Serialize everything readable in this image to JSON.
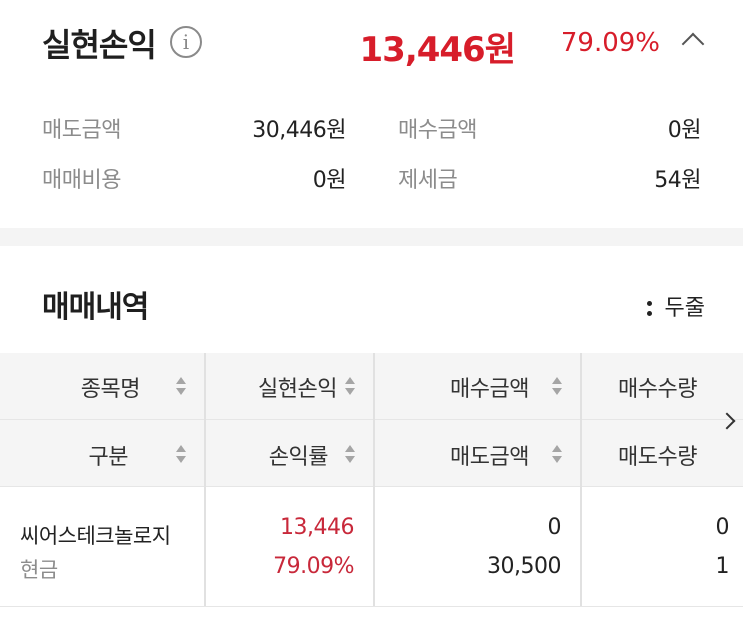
{
  "summary": {
    "title": "실현손익",
    "info_icon": "info-icon",
    "profit": "13,446원",
    "profit_rate": "79.09%",
    "collapse_icon": "chevron-up-icon",
    "sell_amount_label": "매도금액",
    "sell_amount_value": "30,446원",
    "buy_amount_label": "매수금액",
    "buy_amount_value": "0원",
    "trade_cost_label": "매매비용",
    "trade_cost_value": "0원",
    "tax_label": "제세금",
    "tax_value": "54원",
    "accent_color": "#d71d2a"
  },
  "history": {
    "title": "매매내역",
    "toggle_label": "두줄",
    "toggle_icon": "two-dots-icon"
  },
  "table": {
    "headers_row1": [
      "종목명",
      "실현손익",
      "매수금액",
      "매수수량"
    ],
    "headers_row2": [
      "구분",
      "손익률",
      "매도금액",
      "매도수량"
    ],
    "scroll_icon": "chevron-right-icon",
    "rows": [
      {
        "name": "씨어스테크놀로지",
        "type": "현금",
        "profit": "13,446",
        "profit_rate": "79.09%",
        "buy_amount": "0",
        "sell_amount": "30,500",
        "buy_qty": "0",
        "sell_qty": "1"
      }
    ]
  }
}
